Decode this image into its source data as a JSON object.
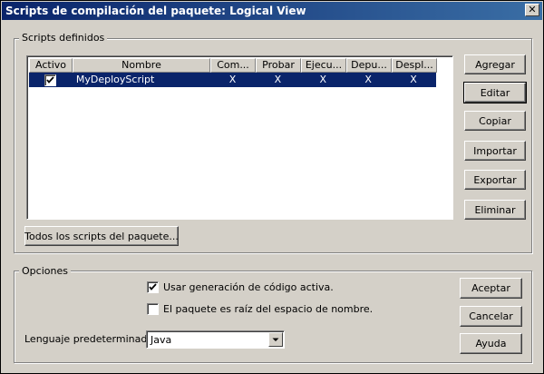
{
  "window": {
    "title": "Scripts de compilación del paquete: Logical View",
    "close_label": "✕"
  },
  "scripts_group": {
    "label": "Scripts definidos",
    "columns": [
      "Activo",
      "Nombre",
      "Com...",
      "Probar",
      "Ejecu...",
      "Depu...",
      "Despl..."
    ],
    "rows": [
      {
        "active": true,
        "name": "MyDeployScript",
        "cells": [
          "X",
          "X",
          "X",
          "X",
          "X"
        ],
        "selected": true
      }
    ],
    "buttons": {
      "add": "Agregar",
      "edit": "Editar",
      "copy": "Copiar",
      "import": "Importar",
      "export": "Exportar",
      "delete": "Eliminar"
    },
    "all_scripts_button": "Todos los scripts del paquete..."
  },
  "options_group": {
    "label": "Opciones",
    "active_codegen": {
      "label": "Usar generación de código activa.",
      "checked": true
    },
    "namespace_root": {
      "label": "El paquete es raíz del espacio de nombre.",
      "checked": false
    },
    "default_language_label": "Lenguaje predeterminado:",
    "default_language_value": "Java"
  },
  "dialog_buttons": {
    "ok": "Aceptar",
    "cancel": "Cancelar",
    "help": "Ayuda"
  },
  "colors": {
    "face": "#d4d0c8",
    "title_start": "#0a246a",
    "title_end": "#3a6ea5",
    "selection": "#0a246a"
  }
}
